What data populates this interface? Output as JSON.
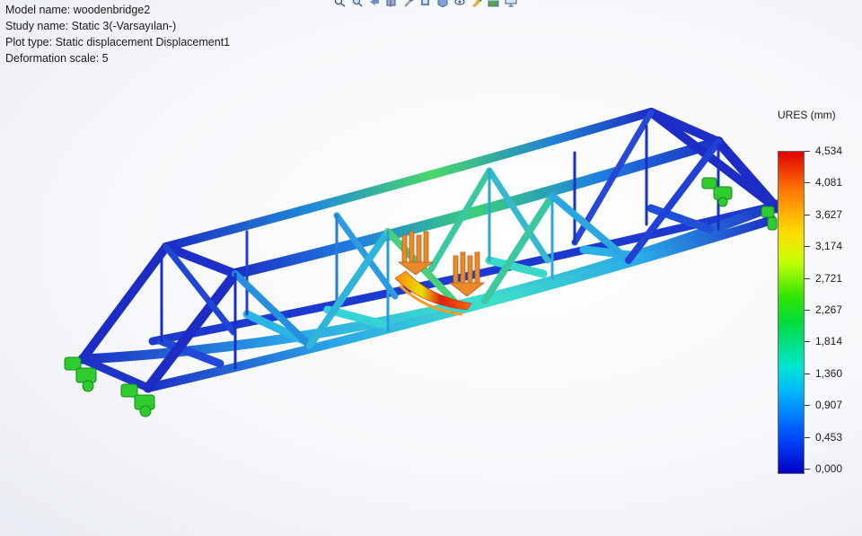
{
  "info": {
    "model_name": "Model name: woodenbridge2",
    "study_name": "Study name: Static 3(-Varsayılan-)",
    "plot_type": "Plot type: Static displacement Displacement1",
    "deformation_scale": "Deformation scale: 5"
  },
  "toolbar": {
    "icons": [
      "search-icon",
      "zoom-icon",
      "previous-view-icon",
      "section-view-icon",
      "tools-icon",
      "display-style-icon",
      "view-orientation-icon",
      "hide-show-icon",
      "appearance-icon",
      "scene-icon",
      "monitor-icon"
    ]
  },
  "legend": {
    "title": "URES (mm)",
    "ticks": [
      "4,534",
      "4,081",
      "3,627",
      "3,174",
      "2,721",
      "2,267",
      "1,814",
      "1,360",
      "0,907",
      "0,453",
      "0,000"
    ],
    "colors": {
      "max": "#e10000",
      "mid": "#00dc3c",
      "min": "#0000c8"
    }
  },
  "colors": {
    "fixture": "#2ecc2e",
    "load": "#e8892a",
    "low_displacement": "#1e2fc0"
  }
}
